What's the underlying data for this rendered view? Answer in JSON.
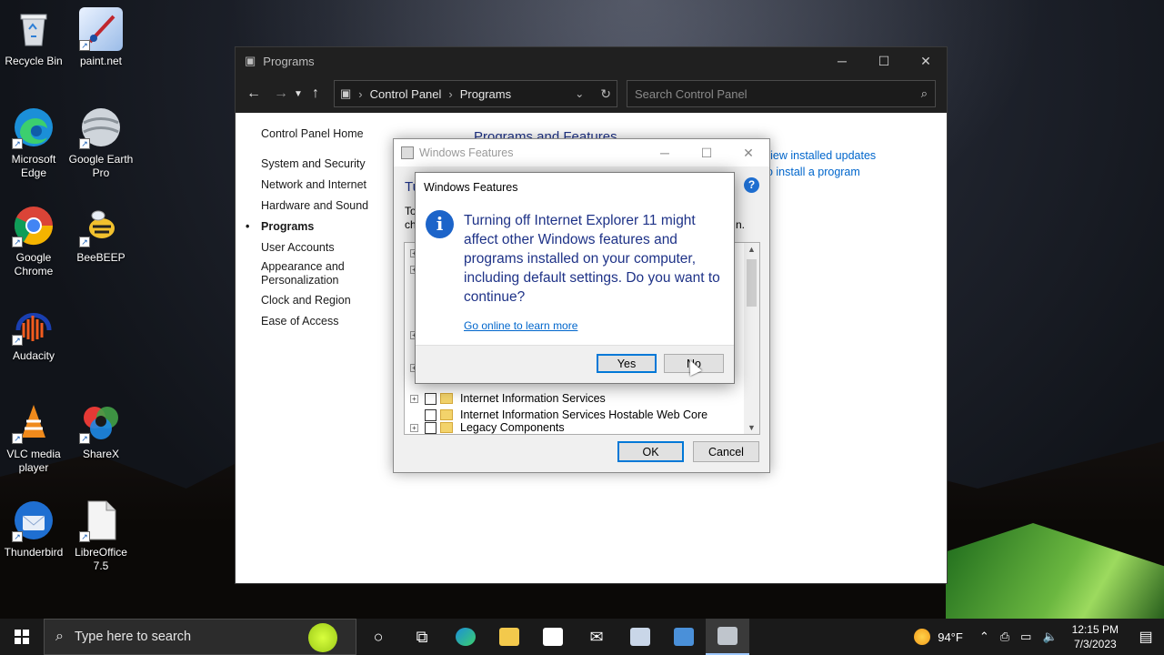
{
  "desktop": {
    "icons": [
      {
        "label": "Recycle Bin",
        "icon": "recycle-bin-icon"
      },
      {
        "label": "paint.net",
        "icon": "paintnet-icon"
      },
      {
        "label": "Microsoft Edge",
        "icon": "edge-icon"
      },
      {
        "label": "Google Earth Pro",
        "icon": "google-earth-icon"
      },
      {
        "label": "Google Chrome",
        "icon": "chrome-icon"
      },
      {
        "label": "BeeBEEP",
        "icon": "beebeep-icon"
      },
      {
        "label": "Audacity",
        "icon": "audacity-icon"
      },
      {
        "label": "VLC media player",
        "icon": "vlc-icon"
      },
      {
        "label": "ShareX",
        "icon": "sharex-icon"
      },
      {
        "label": "Thunderbird",
        "icon": "thunderbird-icon"
      },
      {
        "label": "LibreOffice 7.5",
        "icon": "libreoffice-icon"
      }
    ]
  },
  "cp_window": {
    "title": "Programs",
    "address": {
      "root": "Control Panel",
      "current": "Programs"
    },
    "search_placeholder": "Search Control Panel",
    "sidebar": {
      "home": "Control Panel Home",
      "items": [
        "System and Security",
        "Network and Internet",
        "Hardware and Sound",
        "Programs",
        "User Accounts",
        "Appearance and Personalization",
        "Clock and Region",
        "Ease of Access"
      ],
      "active": "Programs"
    },
    "heading": "Programs and Features",
    "links": [
      "View installed updates",
      "w to install a program"
    ]
  },
  "features_dialog": {
    "title": "Windows Features",
    "heading_fragment": "Tu",
    "desc_fragment_left": "To",
    "desc_fragment_left2": "ch",
    "desc_fragment_right": "n.",
    "help": "?",
    "rows": [
      {
        "label": "Internet Information Services",
        "expandable": true,
        "checked": false
      },
      {
        "label": "Internet Information Services Hostable Web Core",
        "expandable": false,
        "checked": false
      },
      {
        "label": "Legacy Components",
        "expandable": true,
        "checked": false
      }
    ],
    "ok_label": "OK",
    "cancel_label": "Cancel"
  },
  "confirm_dialog": {
    "title": "Windows Features",
    "message": "Turning off Internet Explorer 11 might affect other Windows features and programs installed on your computer, including default settings. Do you want to continue?",
    "link": "Go online to learn more",
    "yes_label": "Yes",
    "no_label": "No",
    "icon": "info-icon",
    "icon_glyph": "i",
    "title_color": "#1e3287"
  },
  "taskbar": {
    "search_placeholder": "Type here to search",
    "weather": "94°F",
    "time": "12:15 PM",
    "date": "7/3/2023"
  },
  "colors": {
    "accent": "#0078d7",
    "link": "#0066cc"
  }
}
